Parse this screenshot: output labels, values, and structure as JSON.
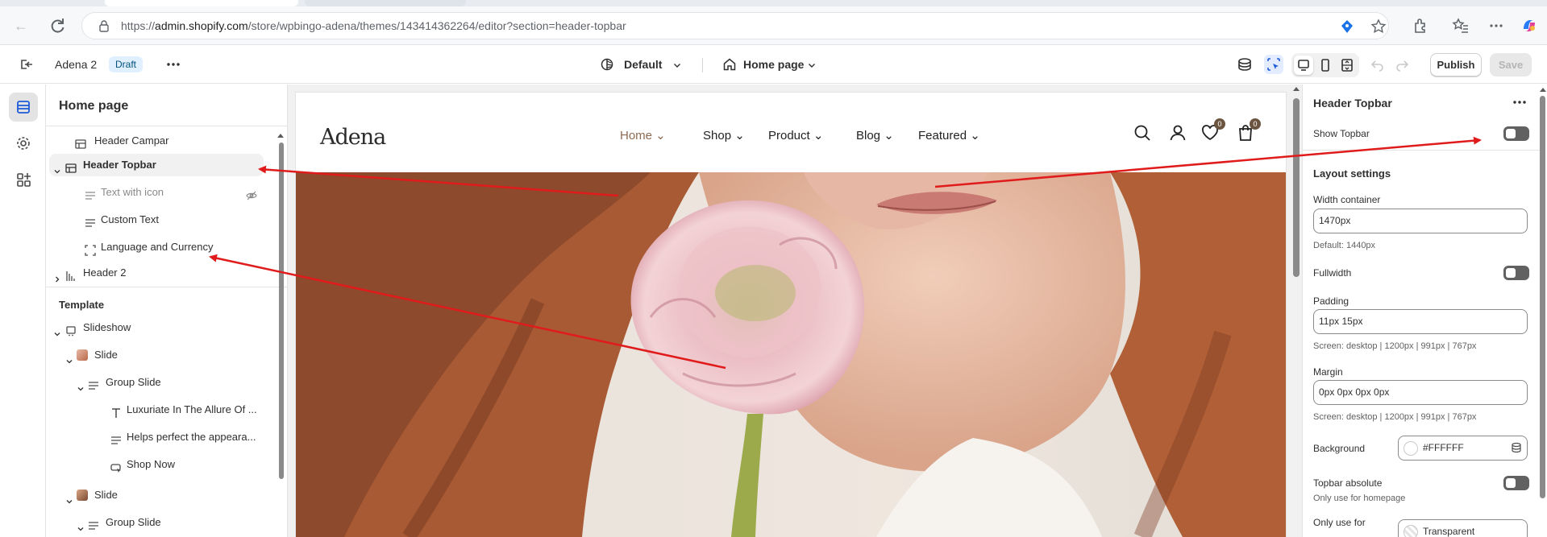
{
  "browser": {
    "url_prefix": "https://",
    "url_domain": "admin.shopify.com",
    "url_path": "/store/wpbingo-adena/themes/143414362264/editor?section=header-topbar"
  },
  "editor": {
    "theme_name": "Adena 2",
    "theme_status": "Draft",
    "preset": "Default",
    "page": "Home page",
    "publish_label": "Publish",
    "save_label": "Save"
  },
  "sidebar": {
    "title": "Home page",
    "header_items": [
      {
        "label": "Header Campar"
      },
      {
        "label": "Header Topbar"
      },
      {
        "label": "Text with icon"
      },
      {
        "label": "Custom Text"
      },
      {
        "label": "Language and Currency"
      },
      {
        "label": "Header 2"
      }
    ],
    "template_title": "Template",
    "template_items": [
      {
        "label": "Slideshow"
      },
      {
        "label": "Slide"
      },
      {
        "label": "Group Slide"
      },
      {
        "label": "Luxuriate In The Allure Of ..."
      },
      {
        "label": "Helps perfect the appeara..."
      },
      {
        "label": "Shop Now"
      },
      {
        "label": "Slide"
      },
      {
        "label": "Group Slide"
      }
    ]
  },
  "store": {
    "logo": "Adena",
    "nav": [
      "Home",
      "Shop",
      "Product",
      "Blog",
      "Featured"
    ],
    "wishlist_count": "0",
    "cart_count": "0"
  },
  "settings": {
    "title": "Header Topbar",
    "show_topbar_label": "Show Topbar",
    "layout_heading": "Layout settings",
    "width_label": "Width container",
    "width_value": "1470px",
    "width_help": "Default: 1440px",
    "fullwidth_label": "Fullwidth",
    "padding_label": "Padding",
    "padding_value": "11px 15px",
    "padding_help": "Screen: desktop | 1200px | 991px | 767px",
    "margin_label": "Margin",
    "margin_value": "0px 0px 0px 0px",
    "margin_help": "Screen: desktop | 1200px | 991px | 767px",
    "background_label": "Background",
    "background_value": "#FFFFFF",
    "absolute_label": "Topbar absolute",
    "absolute_help": "Only use for homepage",
    "only_use_label": "Only use for",
    "only_use_value": "Transparent"
  },
  "colors": {
    "annotation_red": "#e01b1b",
    "draft_badge_bg": "#e0f0ff",
    "nav_active": "#8c6a52"
  }
}
